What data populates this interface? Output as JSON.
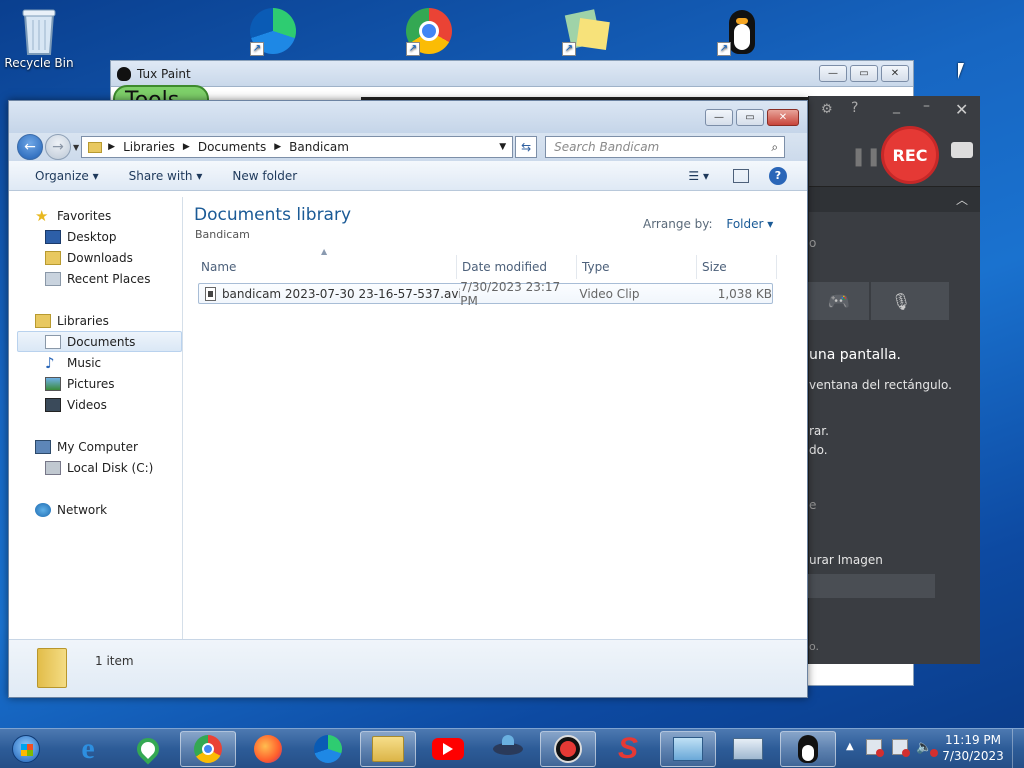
{
  "desktop": {
    "recycle_bin": "Recycle Bin",
    "icons": [
      "recycle-bin-icon",
      "edge-icon",
      "chrome-icon",
      "sticky-notes-icon",
      "tux-paint-icon"
    ]
  },
  "tuxpaint": {
    "title": "Tux Paint",
    "tools_label": "Tools"
  },
  "bandicam": {
    "rec_label": "REC",
    "help_label": "?",
    "lines": [
      "o",
      "una pantalla.",
      "ventana del rectángulo.",
      "rar.",
      "do.",
      "e",
      "urar Imagen",
      "o."
    ]
  },
  "explorer": {
    "breadcrumb": [
      "Libraries",
      "Documents",
      "Bandicam"
    ],
    "search_placeholder": "Search Bandicam",
    "toolbar": {
      "organize": "Organize",
      "share_with": "Share with",
      "new_folder": "New folder"
    },
    "nav": {
      "favorites": "Favorites",
      "favorites_items": [
        "Desktop",
        "Downloads",
        "Recent Places"
      ],
      "libraries": "Libraries",
      "libraries_items": [
        "Documents",
        "Music",
        "Pictures",
        "Videos"
      ],
      "computer": "My Computer",
      "computer_items": [
        "Local Disk (C:)"
      ],
      "network": "Network"
    },
    "library_title": "Documents library",
    "library_subtitle": "Bandicam",
    "arrange_label": "Arrange by:",
    "arrange_value": "Folder",
    "columns": [
      "Name",
      "Date modified",
      "Type",
      "Size"
    ],
    "files": [
      {
        "name": "bandicam 2023-07-30 23-16-57-537.avi",
        "date": "7/30/2023 23:17 PM",
        "type": "Video Clip",
        "size": "1,038 KB"
      }
    ],
    "item_count": "1 item"
  },
  "taskbar": {
    "time": "11:19 PM",
    "date": "7/30/2023",
    "apps": [
      "start-orb",
      "internet-explorer",
      "maps",
      "chrome",
      "firefox",
      "edge",
      "file-explorer",
      "youtube",
      "ufo-app",
      "bandicam",
      "slingshot",
      "control-panel",
      "network-app",
      "tux-paint"
    ]
  },
  "colors": {
    "accent": "#1e395b",
    "title_blue": "#1a5a96",
    "rec": "#e53935"
  }
}
